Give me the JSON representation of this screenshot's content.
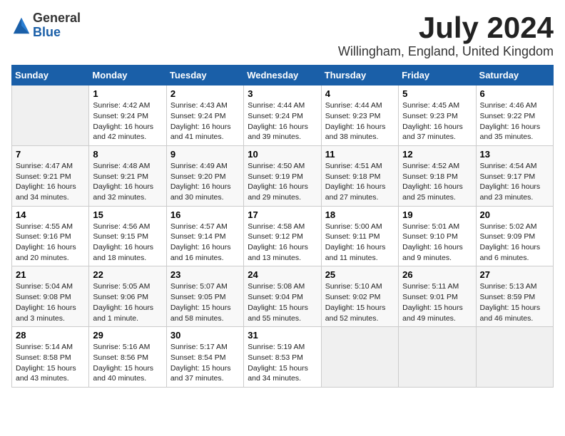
{
  "logo": {
    "general": "General",
    "blue": "Blue"
  },
  "title": "July 2024",
  "location": "Willingham, England, United Kingdom",
  "days_of_week": [
    "Sunday",
    "Monday",
    "Tuesday",
    "Wednesday",
    "Thursday",
    "Friday",
    "Saturday"
  ],
  "weeks": [
    [
      {
        "day": "",
        "info": ""
      },
      {
        "day": "1",
        "info": "Sunrise: 4:42 AM\nSunset: 9:24 PM\nDaylight: 16 hours\nand 42 minutes."
      },
      {
        "day": "2",
        "info": "Sunrise: 4:43 AM\nSunset: 9:24 PM\nDaylight: 16 hours\nand 41 minutes."
      },
      {
        "day": "3",
        "info": "Sunrise: 4:44 AM\nSunset: 9:24 PM\nDaylight: 16 hours\nand 39 minutes."
      },
      {
        "day": "4",
        "info": "Sunrise: 4:44 AM\nSunset: 9:23 PM\nDaylight: 16 hours\nand 38 minutes."
      },
      {
        "day": "5",
        "info": "Sunrise: 4:45 AM\nSunset: 9:23 PM\nDaylight: 16 hours\nand 37 minutes."
      },
      {
        "day": "6",
        "info": "Sunrise: 4:46 AM\nSunset: 9:22 PM\nDaylight: 16 hours\nand 35 minutes."
      }
    ],
    [
      {
        "day": "7",
        "info": "Sunrise: 4:47 AM\nSunset: 9:21 PM\nDaylight: 16 hours\nand 34 minutes."
      },
      {
        "day": "8",
        "info": "Sunrise: 4:48 AM\nSunset: 9:21 PM\nDaylight: 16 hours\nand 32 minutes."
      },
      {
        "day": "9",
        "info": "Sunrise: 4:49 AM\nSunset: 9:20 PM\nDaylight: 16 hours\nand 30 minutes."
      },
      {
        "day": "10",
        "info": "Sunrise: 4:50 AM\nSunset: 9:19 PM\nDaylight: 16 hours\nand 29 minutes."
      },
      {
        "day": "11",
        "info": "Sunrise: 4:51 AM\nSunset: 9:18 PM\nDaylight: 16 hours\nand 27 minutes."
      },
      {
        "day": "12",
        "info": "Sunrise: 4:52 AM\nSunset: 9:18 PM\nDaylight: 16 hours\nand 25 minutes."
      },
      {
        "day": "13",
        "info": "Sunrise: 4:54 AM\nSunset: 9:17 PM\nDaylight: 16 hours\nand 23 minutes."
      }
    ],
    [
      {
        "day": "14",
        "info": "Sunrise: 4:55 AM\nSunset: 9:16 PM\nDaylight: 16 hours\nand 20 minutes."
      },
      {
        "day": "15",
        "info": "Sunrise: 4:56 AM\nSunset: 9:15 PM\nDaylight: 16 hours\nand 18 minutes."
      },
      {
        "day": "16",
        "info": "Sunrise: 4:57 AM\nSunset: 9:14 PM\nDaylight: 16 hours\nand 16 minutes."
      },
      {
        "day": "17",
        "info": "Sunrise: 4:58 AM\nSunset: 9:12 PM\nDaylight: 16 hours\nand 13 minutes."
      },
      {
        "day": "18",
        "info": "Sunrise: 5:00 AM\nSunset: 9:11 PM\nDaylight: 16 hours\nand 11 minutes."
      },
      {
        "day": "19",
        "info": "Sunrise: 5:01 AM\nSunset: 9:10 PM\nDaylight: 16 hours\nand 9 minutes."
      },
      {
        "day": "20",
        "info": "Sunrise: 5:02 AM\nSunset: 9:09 PM\nDaylight: 16 hours\nand 6 minutes."
      }
    ],
    [
      {
        "day": "21",
        "info": "Sunrise: 5:04 AM\nSunset: 9:08 PM\nDaylight: 16 hours\nand 3 minutes."
      },
      {
        "day": "22",
        "info": "Sunrise: 5:05 AM\nSunset: 9:06 PM\nDaylight: 16 hours\nand 1 minute."
      },
      {
        "day": "23",
        "info": "Sunrise: 5:07 AM\nSunset: 9:05 PM\nDaylight: 15 hours\nand 58 minutes."
      },
      {
        "day": "24",
        "info": "Sunrise: 5:08 AM\nSunset: 9:04 PM\nDaylight: 15 hours\nand 55 minutes."
      },
      {
        "day": "25",
        "info": "Sunrise: 5:10 AM\nSunset: 9:02 PM\nDaylight: 15 hours\nand 52 minutes."
      },
      {
        "day": "26",
        "info": "Sunrise: 5:11 AM\nSunset: 9:01 PM\nDaylight: 15 hours\nand 49 minutes."
      },
      {
        "day": "27",
        "info": "Sunrise: 5:13 AM\nSunset: 8:59 PM\nDaylight: 15 hours\nand 46 minutes."
      }
    ],
    [
      {
        "day": "28",
        "info": "Sunrise: 5:14 AM\nSunset: 8:58 PM\nDaylight: 15 hours\nand 43 minutes."
      },
      {
        "day": "29",
        "info": "Sunrise: 5:16 AM\nSunset: 8:56 PM\nDaylight: 15 hours\nand 40 minutes."
      },
      {
        "day": "30",
        "info": "Sunrise: 5:17 AM\nSunset: 8:54 PM\nDaylight: 15 hours\nand 37 minutes."
      },
      {
        "day": "31",
        "info": "Sunrise: 5:19 AM\nSunset: 8:53 PM\nDaylight: 15 hours\nand 34 minutes."
      },
      {
        "day": "",
        "info": ""
      },
      {
        "day": "",
        "info": ""
      },
      {
        "day": "",
        "info": ""
      }
    ]
  ]
}
